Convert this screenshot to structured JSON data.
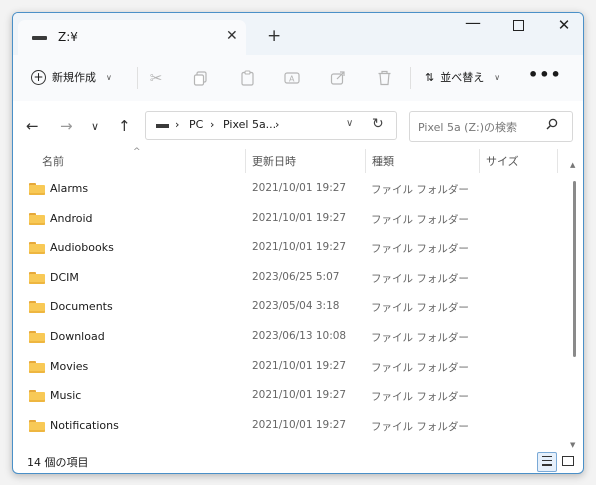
{
  "tab": {
    "title": "Z:¥",
    "close": "✕",
    "new_tab": "+"
  },
  "window_controls": {
    "minimize": "—",
    "close": "✕"
  },
  "toolbar": {
    "new_label": "新規作成",
    "sort_label": "並べ替え",
    "more": "•••",
    "icons": [
      "cut-icon",
      "copy-icon",
      "paste-icon",
      "rename-icon",
      "share-icon",
      "delete-icon"
    ]
  },
  "nav": {
    "back": "←",
    "forward": "→",
    "recent": "∨",
    "up": "↑",
    "breadcrumb": [
      "PC",
      "Pixel 5a..."
    ],
    "separator": "›",
    "refresh": "↻",
    "dropdown": "∨"
  },
  "search": {
    "placeholder": "Pixel 5a (Z:)の検索"
  },
  "columns": {
    "name": "名前",
    "date": "更新日時",
    "type": "種類",
    "size": "サイズ"
  },
  "files": [
    {
      "name": "Alarms",
      "date": "2021/10/01 19:27",
      "type": "ファイル フォルダー"
    },
    {
      "name": "Android",
      "date": "2021/10/01 19:27",
      "type": "ファイル フォルダー"
    },
    {
      "name": "Audiobooks",
      "date": "2021/10/01 19:27",
      "type": "ファイル フォルダー"
    },
    {
      "name": "DCIM",
      "date": "2023/06/25 5:07",
      "type": "ファイル フォルダー"
    },
    {
      "name": "Documents",
      "date": "2023/05/04 3:18",
      "type": "ファイル フォルダー"
    },
    {
      "name": "Download",
      "date": "2023/06/13 10:08",
      "type": "ファイル フォルダー"
    },
    {
      "name": "Movies",
      "date": "2021/10/01 19:27",
      "type": "ファイル フォルダー"
    },
    {
      "name": "Music",
      "date": "2021/10/01 19:27",
      "type": "ファイル フォルダー"
    },
    {
      "name": "Notifications",
      "date": "2021/10/01 19:27",
      "type": "ファイル フォルダー"
    }
  ],
  "status": {
    "count": "14 個の項目"
  },
  "colors": {
    "accent": "#4a90c8",
    "folder": "#f8c956"
  }
}
